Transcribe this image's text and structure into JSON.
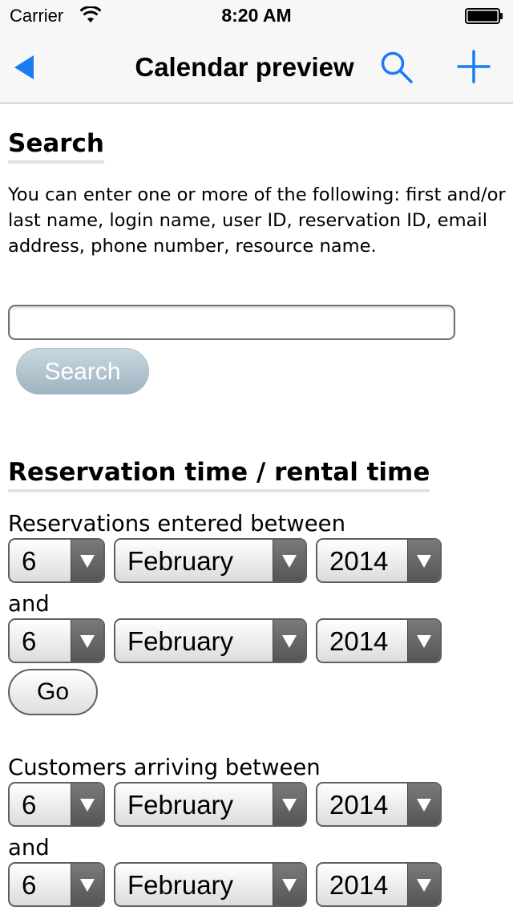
{
  "status_bar": {
    "carrier": "Carrier",
    "time": "8:20 AM"
  },
  "nav": {
    "title": "Calendar preview",
    "accent_color": "#1a7cf5"
  },
  "search": {
    "heading": "Search",
    "description": "You can enter one or more of the following: first and/or last name, login name, user ID, reservation ID, email address, phone number, resource name.",
    "input_value": "",
    "button_label": "Search"
  },
  "reservation": {
    "heading": "Reservation time / rental time",
    "entered": {
      "label": "Reservations entered between",
      "from": {
        "day": "6",
        "month": "February",
        "year": "2014"
      },
      "and_label": "and",
      "to": {
        "day": "6",
        "month": "February",
        "year": "2014"
      }
    },
    "go_label": "Go",
    "arriving": {
      "label": "Customers arriving between",
      "from": {
        "day": "6",
        "month": "February",
        "year": "2014"
      },
      "and_label": "and",
      "to": {
        "day": "6",
        "month": "February",
        "year": "2014"
      }
    }
  }
}
